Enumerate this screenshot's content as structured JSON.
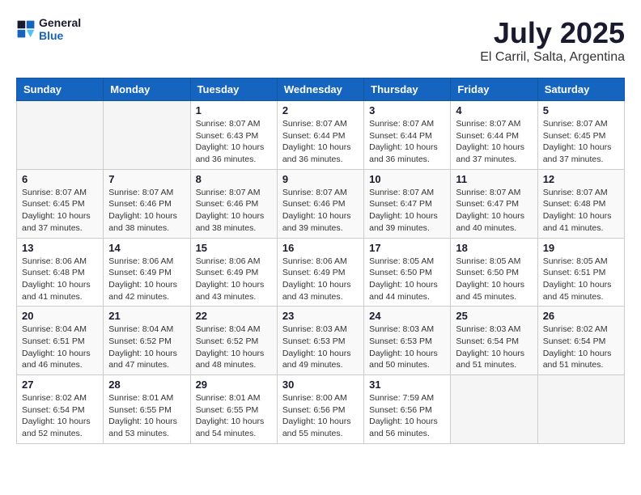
{
  "header": {
    "logo_general": "General",
    "logo_blue": "Blue",
    "title": "July 2025",
    "subtitle": "El Carril, Salta, Argentina"
  },
  "calendar": {
    "weekdays": [
      "Sunday",
      "Monday",
      "Tuesday",
      "Wednesday",
      "Thursday",
      "Friday",
      "Saturday"
    ],
    "weeks": [
      [
        {
          "day": "",
          "info": ""
        },
        {
          "day": "",
          "info": ""
        },
        {
          "day": "1",
          "info": "Sunrise: 8:07 AM\nSunset: 6:43 PM\nDaylight: 10 hours and 36 minutes."
        },
        {
          "day": "2",
          "info": "Sunrise: 8:07 AM\nSunset: 6:44 PM\nDaylight: 10 hours and 36 minutes."
        },
        {
          "day": "3",
          "info": "Sunrise: 8:07 AM\nSunset: 6:44 PM\nDaylight: 10 hours and 36 minutes."
        },
        {
          "day": "4",
          "info": "Sunrise: 8:07 AM\nSunset: 6:44 PM\nDaylight: 10 hours and 37 minutes."
        },
        {
          "day": "5",
          "info": "Sunrise: 8:07 AM\nSunset: 6:45 PM\nDaylight: 10 hours and 37 minutes."
        }
      ],
      [
        {
          "day": "6",
          "info": "Sunrise: 8:07 AM\nSunset: 6:45 PM\nDaylight: 10 hours and 37 minutes."
        },
        {
          "day": "7",
          "info": "Sunrise: 8:07 AM\nSunset: 6:46 PM\nDaylight: 10 hours and 38 minutes."
        },
        {
          "day": "8",
          "info": "Sunrise: 8:07 AM\nSunset: 6:46 PM\nDaylight: 10 hours and 38 minutes."
        },
        {
          "day": "9",
          "info": "Sunrise: 8:07 AM\nSunset: 6:46 PM\nDaylight: 10 hours and 39 minutes."
        },
        {
          "day": "10",
          "info": "Sunrise: 8:07 AM\nSunset: 6:47 PM\nDaylight: 10 hours and 39 minutes."
        },
        {
          "day": "11",
          "info": "Sunrise: 8:07 AM\nSunset: 6:47 PM\nDaylight: 10 hours and 40 minutes."
        },
        {
          "day": "12",
          "info": "Sunrise: 8:07 AM\nSunset: 6:48 PM\nDaylight: 10 hours and 41 minutes."
        }
      ],
      [
        {
          "day": "13",
          "info": "Sunrise: 8:06 AM\nSunset: 6:48 PM\nDaylight: 10 hours and 41 minutes."
        },
        {
          "day": "14",
          "info": "Sunrise: 8:06 AM\nSunset: 6:49 PM\nDaylight: 10 hours and 42 minutes."
        },
        {
          "day": "15",
          "info": "Sunrise: 8:06 AM\nSunset: 6:49 PM\nDaylight: 10 hours and 43 minutes."
        },
        {
          "day": "16",
          "info": "Sunrise: 8:06 AM\nSunset: 6:49 PM\nDaylight: 10 hours and 43 minutes."
        },
        {
          "day": "17",
          "info": "Sunrise: 8:05 AM\nSunset: 6:50 PM\nDaylight: 10 hours and 44 minutes."
        },
        {
          "day": "18",
          "info": "Sunrise: 8:05 AM\nSunset: 6:50 PM\nDaylight: 10 hours and 45 minutes."
        },
        {
          "day": "19",
          "info": "Sunrise: 8:05 AM\nSunset: 6:51 PM\nDaylight: 10 hours and 45 minutes."
        }
      ],
      [
        {
          "day": "20",
          "info": "Sunrise: 8:04 AM\nSunset: 6:51 PM\nDaylight: 10 hours and 46 minutes."
        },
        {
          "day": "21",
          "info": "Sunrise: 8:04 AM\nSunset: 6:52 PM\nDaylight: 10 hours and 47 minutes."
        },
        {
          "day": "22",
          "info": "Sunrise: 8:04 AM\nSunset: 6:52 PM\nDaylight: 10 hours and 48 minutes."
        },
        {
          "day": "23",
          "info": "Sunrise: 8:03 AM\nSunset: 6:53 PM\nDaylight: 10 hours and 49 minutes."
        },
        {
          "day": "24",
          "info": "Sunrise: 8:03 AM\nSunset: 6:53 PM\nDaylight: 10 hours and 50 minutes."
        },
        {
          "day": "25",
          "info": "Sunrise: 8:03 AM\nSunset: 6:54 PM\nDaylight: 10 hours and 51 minutes."
        },
        {
          "day": "26",
          "info": "Sunrise: 8:02 AM\nSunset: 6:54 PM\nDaylight: 10 hours and 51 minutes."
        }
      ],
      [
        {
          "day": "27",
          "info": "Sunrise: 8:02 AM\nSunset: 6:54 PM\nDaylight: 10 hours and 52 minutes."
        },
        {
          "day": "28",
          "info": "Sunrise: 8:01 AM\nSunset: 6:55 PM\nDaylight: 10 hours and 53 minutes."
        },
        {
          "day": "29",
          "info": "Sunrise: 8:01 AM\nSunset: 6:55 PM\nDaylight: 10 hours and 54 minutes."
        },
        {
          "day": "30",
          "info": "Sunrise: 8:00 AM\nSunset: 6:56 PM\nDaylight: 10 hours and 55 minutes."
        },
        {
          "day": "31",
          "info": "Sunrise: 7:59 AM\nSunset: 6:56 PM\nDaylight: 10 hours and 56 minutes."
        },
        {
          "day": "",
          "info": ""
        },
        {
          "day": "",
          "info": ""
        }
      ]
    ]
  }
}
